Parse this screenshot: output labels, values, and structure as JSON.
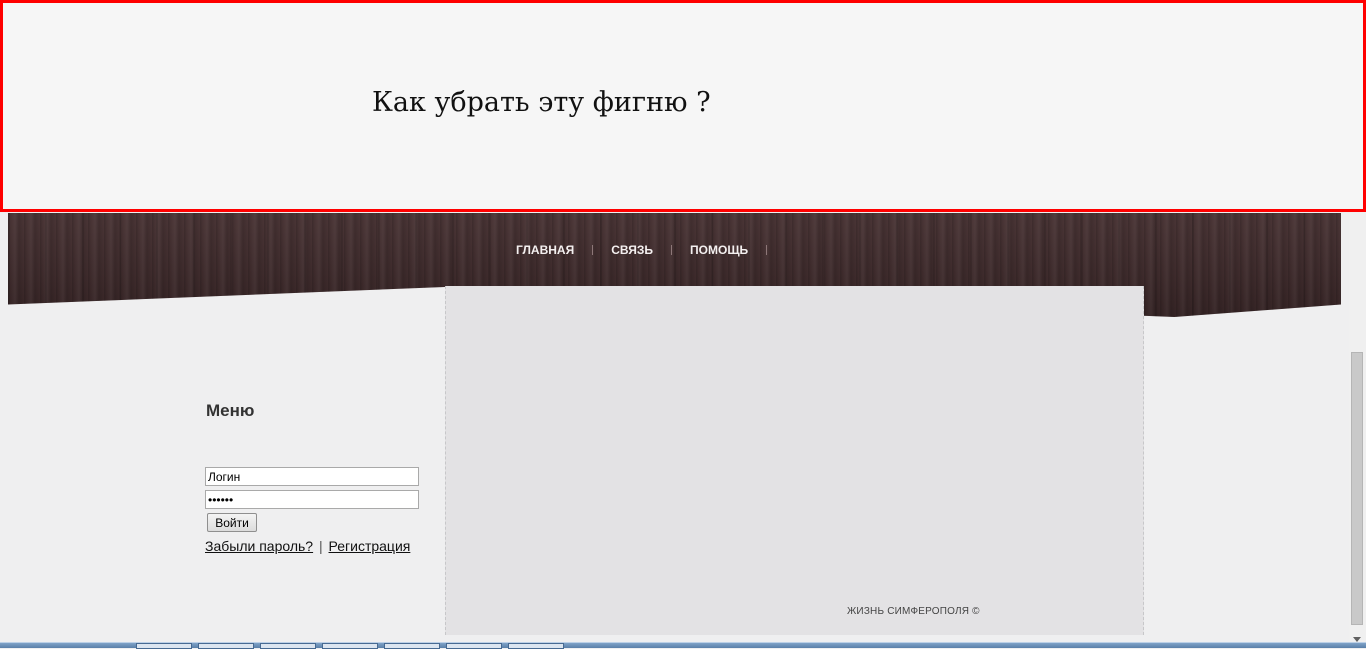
{
  "annotation": {
    "text": "Как убрать эту фигню ?"
  },
  "nav": {
    "items": [
      {
        "label": "ГЛАВНАЯ"
      },
      {
        "label": "СВЯЗЬ"
      },
      {
        "label": "ПОМОЩЬ"
      }
    ]
  },
  "sidebar": {
    "title": "Меню",
    "login_value": "Логин",
    "password_value": "••••••",
    "submit_label": "Войти",
    "forgot_link": "Забыли пароль?",
    "separator": "|",
    "register_link": "Регистрация"
  },
  "footer": {
    "copyright": "ЖИЗНЬ СИМФЕРОПОЛЯ ©"
  },
  "colors": {
    "annotation_border": "#ff0000",
    "header_wood": "#3e2b2c",
    "nav_text": "#f4f0f0"
  },
  "icons": {
    "scroll_down": "triangle-down-icon"
  }
}
